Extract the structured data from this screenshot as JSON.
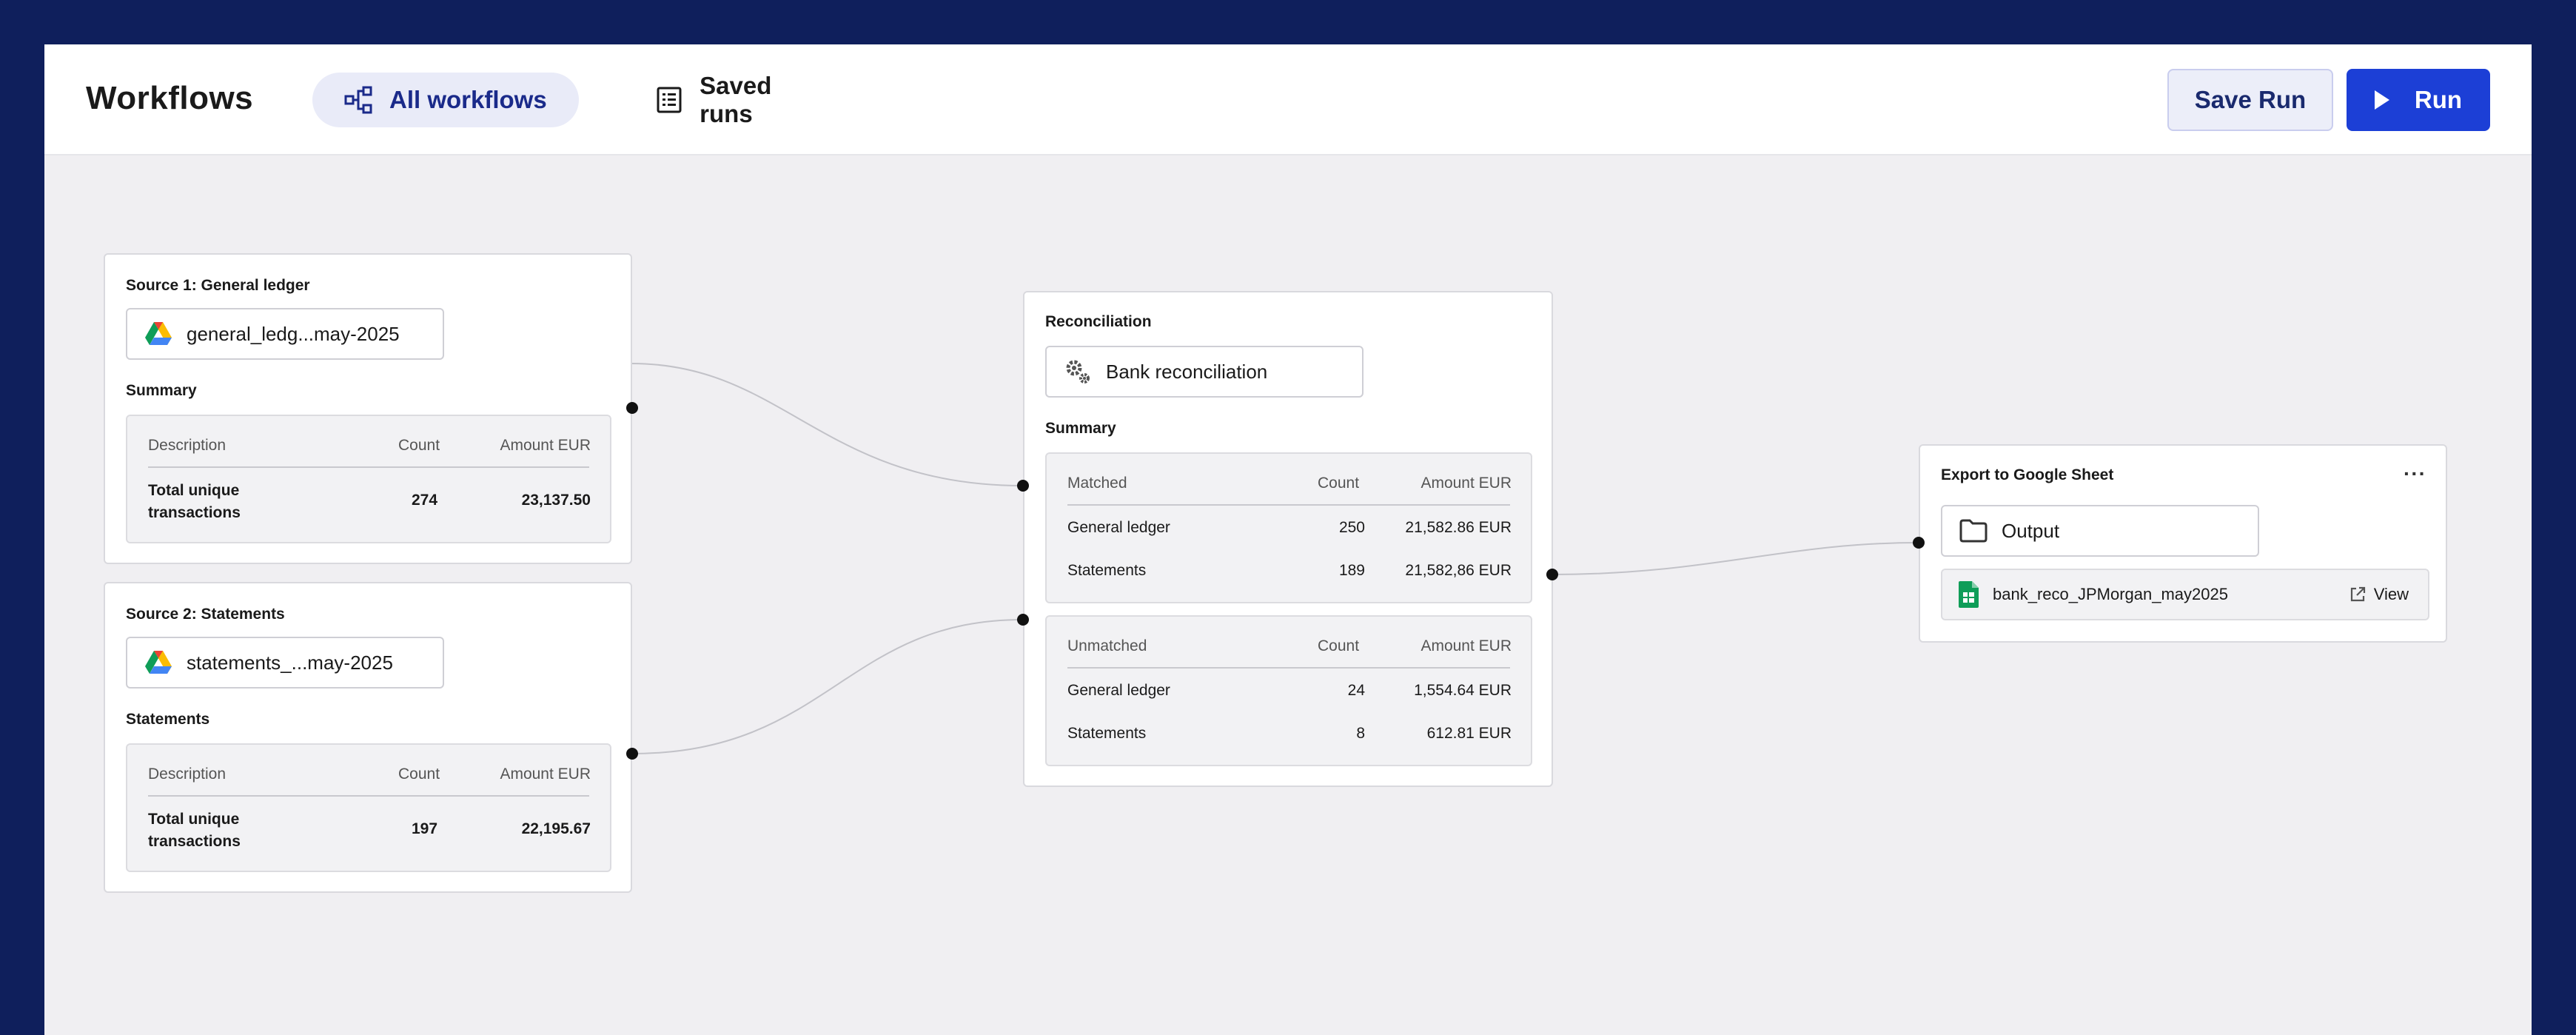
{
  "header": {
    "title": "Workflows",
    "tabs": [
      {
        "label": "All workflows",
        "icon": "workflow-icon",
        "active": true
      },
      {
        "label": "Saved runs",
        "icon": "list-icon",
        "active": false
      }
    ],
    "save_label": "Save Run",
    "run_label": "Run"
  },
  "source1": {
    "title": "Source 1:  General ledger",
    "file": "general_ledg...may-2025",
    "file_icon": "google-drive-icon",
    "section": "Summary",
    "columns": [
      "Description",
      "Count",
      "Amount EUR"
    ],
    "rows": [
      {
        "description": "Total unique\ntransactions",
        "count": "274",
        "amount": "23,137.50"
      }
    ]
  },
  "source2": {
    "title": "Source 2:  Statements",
    "file": "statements_...may-2025",
    "file_icon": "google-drive-icon",
    "section": "Statements",
    "columns": [
      "Description",
      "Count",
      "Amount EUR"
    ],
    "rows": [
      {
        "description": "Total unique\ntransactions",
        "count": "197",
        "amount": "22,195.67"
      }
    ]
  },
  "reconciliation": {
    "title": "Reconciliation",
    "step": "Bank reconciliation",
    "step_icon": "gears-icon",
    "section": "Summary",
    "matched": {
      "columns": [
        "Matched",
        "Count",
        "Amount EUR"
      ],
      "rows": [
        {
          "label": "General ledger",
          "count": "250",
          "amount": "21,582.86 EUR"
        },
        {
          "label": "Statements",
          "count": "189",
          "amount": "21,582,86 EUR"
        }
      ]
    },
    "unmatched": {
      "columns": [
        "Unmatched",
        "Count",
        "Amount EUR"
      ],
      "rows": [
        {
          "label": "General ledger",
          "count": "24",
          "amount": "1,554.64 EUR"
        },
        {
          "label": "Statements",
          "count": "8",
          "amount": "612.81 EUR"
        }
      ]
    }
  },
  "export": {
    "title": "Export to Google Sheet",
    "more": "···",
    "folder": "Output",
    "folder_icon": "folder-icon",
    "file": "bank_reco_JPMorgan_may2025",
    "file_icon": "google-sheets-icon",
    "view_label": "View",
    "view_icon": "external-link-icon"
  },
  "colors": {
    "frame": "#0f1f5c",
    "accent": "#1c3fd6",
    "canvas": "#f0eff2"
  }
}
